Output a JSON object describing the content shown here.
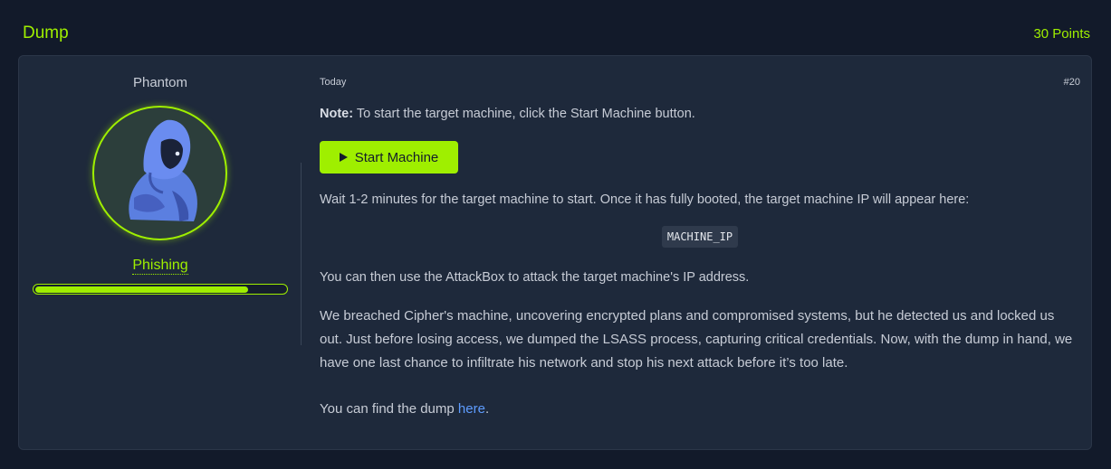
{
  "task": {
    "title": "Dump",
    "points": "30 Points"
  },
  "author": {
    "name": "Phantom",
    "rank": "Phishing",
    "rank_progress": 0.85,
    "avatar_icon": "hooded-figure-icon"
  },
  "post": {
    "date": "Today",
    "number": "#20",
    "note_label": "Note:",
    "note_text": " To start the target machine, click the Start Machine button.",
    "start_button": "Start Machine",
    "wait_text": "Wait 1-2 minutes for the target machine to start. Once it has fully booted, the target machine IP will appear here:",
    "machine_ip": "MACHINE_IP",
    "attackbox_text": "You can then use the AttackBox to attack the target machine's IP address.",
    "story_text": "We breached Cipher's machine, uncovering encrypted plans and compromised systems, but he detected us and locked us out. Just before losing access, we dumped the LSASS process, capturing critical credentials. Now, with the dump in hand, we have one last chance to infiltrate his network and stop his next attack before it’s too late.",
    "find_prefix": "You can find the dump ",
    "find_link": "here",
    "find_suffix": "."
  },
  "colors": {
    "accent": "#9fef00",
    "background": "#121a2a",
    "card": "#1e293b",
    "link": "#5e9cff"
  }
}
